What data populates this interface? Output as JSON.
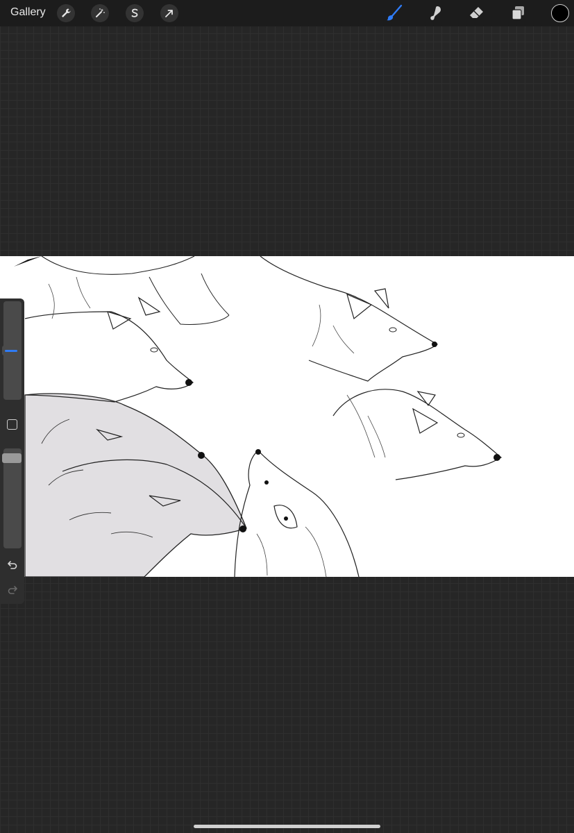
{
  "topbar": {
    "gallery_label": "Gallery",
    "left_tools": [
      {
        "name": "actions",
        "icon": "wrench-icon"
      },
      {
        "name": "adjustments",
        "icon": "magic-wand-icon"
      },
      {
        "name": "selection",
        "icon": "selection-s-icon"
      },
      {
        "name": "transform",
        "icon": "arrow-cursor-icon"
      }
    ],
    "right_tools": [
      {
        "name": "brush",
        "icon": "brush-icon",
        "active": true
      },
      {
        "name": "smudge",
        "icon": "smudge-icon",
        "active": false
      },
      {
        "name": "eraser",
        "icon": "eraser-icon",
        "active": false
      },
      {
        "name": "layers",
        "icon": "layers-icon",
        "active": false
      }
    ],
    "current_color": "#000000",
    "active_color": "#2f7bf5"
  },
  "sidebar": {
    "brush_size_level": 0.5,
    "opacity_level": 0.05,
    "modify_icon": "square-icon",
    "undo_icon": "undo-icon",
    "redo_icon": "redo-icon"
  },
  "canvas": {
    "background": "#ffffff",
    "content": "line-art-wolves-icon"
  }
}
